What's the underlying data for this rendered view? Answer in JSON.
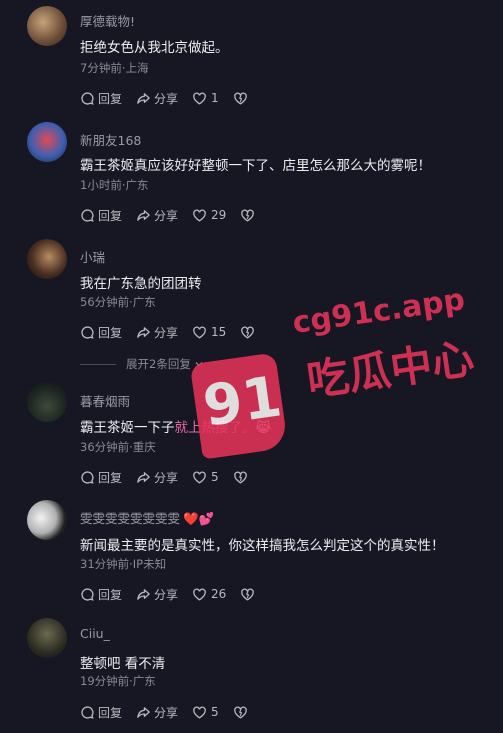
{
  "icons": {
    "reply": "reply-icon",
    "share": "share-icon",
    "like": "heart-icon",
    "dislike": "broken-heart-icon"
  },
  "colors": {
    "background": "#161722",
    "highlight": "#e36aa6",
    "watermark": "#e8345a"
  },
  "comments": [
    {
      "username": "厚德载物!",
      "text": "拒绝女色从我北京做起。",
      "meta": "7分钟前·上海",
      "reply": "回复",
      "share": "分享",
      "likes": "1"
    },
    {
      "username": "新朋友168",
      "text": "霸王茶姬真应该好好整顿一下了、店里怎么那么大的雾呢！",
      "meta": "1小时前·广东",
      "reply": "回复",
      "share": "分享",
      "likes": "29"
    },
    {
      "username": "小瑞",
      "text": "我在广东急的团团转",
      "meta": "56分钟前·广东",
      "reply": "回复",
      "share": "分享",
      "likes": "15"
    },
    {
      "username": "暮春烟雨",
      "text_a": "霸王茶姬一下子",
      "text_b": "就上热搜了。",
      "text_emoji": "😹",
      "meta": "36分钟前·重庆",
      "reply": "回复",
      "share": "分享",
      "likes": "5"
    },
    {
      "username": "雯雯雯雯雯雯雯雯",
      "username_emoji": "❤️💕",
      "text": "新闻最主要的是真实性，你这样搞我怎么判定这个的真实性！",
      "meta": "31分钟前·IP未知",
      "reply": "回复",
      "share": "分享",
      "likes": "26"
    },
    {
      "username": "Ciiu_",
      "text": "整顿吧 看不清",
      "meta": "19分钟前·广东",
      "reply": "回复",
      "share": "分享",
      "likes": "5"
    }
  ],
  "expand_replies": "展开2条回复",
  "watermark": {
    "logo": "91",
    "site": "cg91c.app",
    "cn": "吃瓜中心"
  }
}
